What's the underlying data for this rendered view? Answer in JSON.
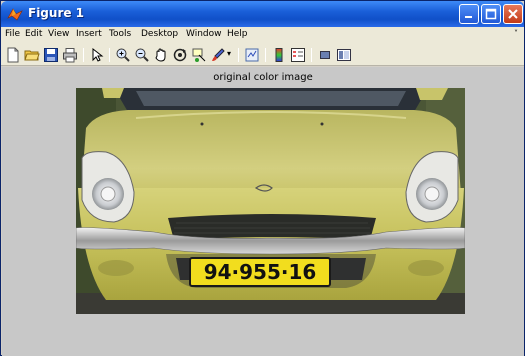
{
  "window": {
    "title": "Figure 1"
  },
  "menu": {
    "items": [
      "File",
      "Edit",
      "View",
      "Insert",
      "Tools",
      "Desktop",
      "Window",
      "Help"
    ],
    "overflow_arrow": "˅"
  },
  "toolbar": {
    "icons": [
      "new-figure-icon",
      "open-file-icon",
      "save-icon",
      "print-icon",
      "select-arrow-icon",
      "zoom-in-icon",
      "zoom-out-icon",
      "pan-hand-icon",
      "rotate-3d-icon",
      "data-cursor-icon",
      "brush-icon",
      "link-plot-icon",
      "colorbar-icon",
      "legend-icon",
      "hide-plot-tools-icon",
      "show-plot-tools-icon"
    ]
  },
  "figure": {
    "axes_title": "original color image",
    "image": {
      "subject": "car-front",
      "plate_text": "94·955·16",
      "car_color": "#c7c25a",
      "plate_color": "#f2dd1e"
    }
  }
}
